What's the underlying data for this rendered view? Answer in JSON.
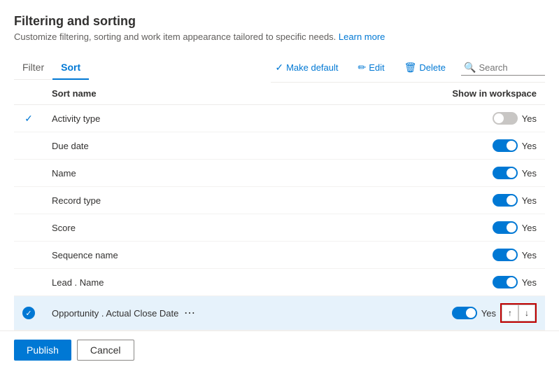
{
  "page": {
    "title": "Filtering and sorting",
    "subtitle": "Customize filtering, sorting and work item appearance tailored to specific needs.",
    "learn_more": "Learn more"
  },
  "tabs": [
    {
      "label": "Filter",
      "active": false
    },
    {
      "label": "Sort",
      "active": true
    }
  ],
  "toolbar": {
    "make_default": "Make default",
    "edit": "Edit",
    "delete": "Delete",
    "search_placeholder": "Search"
  },
  "table": {
    "col_sort_name": "Sort name",
    "col_show": "Show in workspace",
    "rows": [
      {
        "id": 1,
        "name": "Activity type",
        "checked": true,
        "toggle": false,
        "toggle_label": "Yes",
        "selected": false
      },
      {
        "id": 2,
        "name": "Due date",
        "checked": false,
        "toggle": true,
        "toggle_label": "Yes",
        "selected": false
      },
      {
        "id": 3,
        "name": "Name",
        "checked": false,
        "toggle": true,
        "toggle_label": "Yes",
        "selected": false
      },
      {
        "id": 4,
        "name": "Record type",
        "checked": false,
        "toggle": true,
        "toggle_label": "Yes",
        "selected": false
      },
      {
        "id": 5,
        "name": "Score",
        "checked": false,
        "toggle": true,
        "toggle_label": "Yes",
        "selected": false
      },
      {
        "id": 6,
        "name": "Sequence name",
        "checked": false,
        "toggle": true,
        "toggle_label": "Yes",
        "selected": false
      },
      {
        "id": 7,
        "name": "Lead . Name",
        "checked": false,
        "toggle": true,
        "toggle_label": "Yes",
        "selected": false
      },
      {
        "id": 8,
        "name": "Opportunity . Actual Close Date",
        "checked": false,
        "toggle": true,
        "toggle_label": "Yes",
        "selected": true,
        "has_ellipsis": true,
        "has_move": true
      }
    ]
  },
  "footer": {
    "publish_label": "Publish",
    "cancel_label": "Cancel"
  }
}
